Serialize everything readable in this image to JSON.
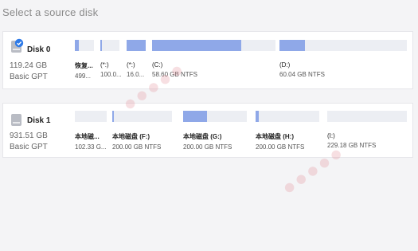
{
  "heading": "Select a source disk",
  "colors": {
    "fill": "#8fa8e8",
    "bar_bg": "#eceef3",
    "selected_check": "#2f7be8"
  },
  "disks": [
    {
      "name": "Disk 0",
      "size": "119.24 GB",
      "type": "Basic GPT",
      "selected": true,
      "partitions": [
        {
          "label": "恢复...",
          "detail": "499...",
          "fill": 0.2
        },
        {
          "label": "(*:)",
          "detail": "100.0...",
          "fill": 0.1
        },
        {
          "label": "(*:)",
          "detail": "16.0...",
          "fill": 1.0
        },
        {
          "label": "(C:)",
          "detail": "58.60 GB NTFS",
          "fill": 0.72
        },
        {
          "label": "(D:)",
          "detail": "60.04 GB NTFS",
          "fill": 0.2
        }
      ]
    },
    {
      "name": "Disk 1",
      "size": "931.51 GB",
      "type": "Basic GPT",
      "selected": false,
      "partitions": [
        {
          "label": "本地磁...",
          "detail": "102.33 G...",
          "fill": 0.0
        },
        {
          "label": "本地磁盘 (F:)",
          "detail": "200.00 GB NTFS",
          "fill": 0.03
        },
        {
          "label": "本地磁盘 (G:)",
          "detail": "200.00 GB NTFS",
          "fill": 0.38
        },
        {
          "label": "本地磁盘 (H:)",
          "detail": "200.00 GB NTFS",
          "fill": 0.05
        },
        {
          "label": "(I:)",
          "detail": "229.18 GB NTFS",
          "fill": 0.0
        }
      ]
    }
  ]
}
